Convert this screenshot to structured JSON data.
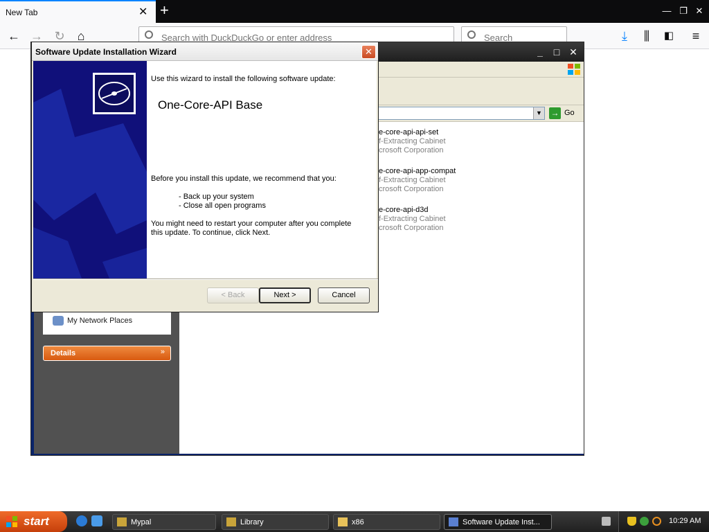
{
  "browser": {
    "tab_title": "New Tab",
    "tab_close": "✕",
    "new_tab": "+",
    "url_placeholder": "Search with DuckDuckGo or enter address",
    "search_placeholder": "Search",
    "window_controls": {
      "minimize": "—",
      "restore": "❐",
      "close": "✕"
    }
  },
  "explorer": {
    "go_label": "Go",
    "files": [
      {
        "name": "e-core-api-api-set",
        "type": "f-Extracting Cabinet",
        "company": "crosoft Corporation"
      },
      {
        "name": "e-core-api-app-compat",
        "type": "f-Extracting Cabinet",
        "company": "crosoft Corporation"
      },
      {
        "name": "e-core-api-d3d",
        "type": "f-Extracting Cabinet",
        "company": "crosoft Corporation"
      }
    ],
    "sidebar": {
      "network_places": "My Network Places",
      "details_label": "Details",
      "details_chevron": "»"
    }
  },
  "wizard": {
    "title": "Software Update Installation Wizard",
    "close": "✕",
    "intro": "Use this wizard to install the following software update:",
    "product": "One-Core-API Base",
    "recommend": "Before you install this update, we recommend that you:",
    "step1": "- Back up your system",
    "step2": "- Close all open programs",
    "restart_line1": "You might need to restart your computer after you complete",
    "restart_line2": "this update. To continue, click Next.",
    "back_label": "< Back",
    "next_label": "Next >",
    "cancel_label": "Cancel"
  },
  "taskbar": {
    "start_label": "start",
    "tasks": [
      {
        "label": "Mypal"
      },
      {
        "label": "Library"
      },
      {
        "label": "x86"
      },
      {
        "label": "Software Update Inst..."
      }
    ],
    "clock": "10:29 AM"
  },
  "colors": {
    "xp_start": "#d9531a",
    "wizard_banner": "#10107a",
    "details_orange": "#e06a20"
  }
}
